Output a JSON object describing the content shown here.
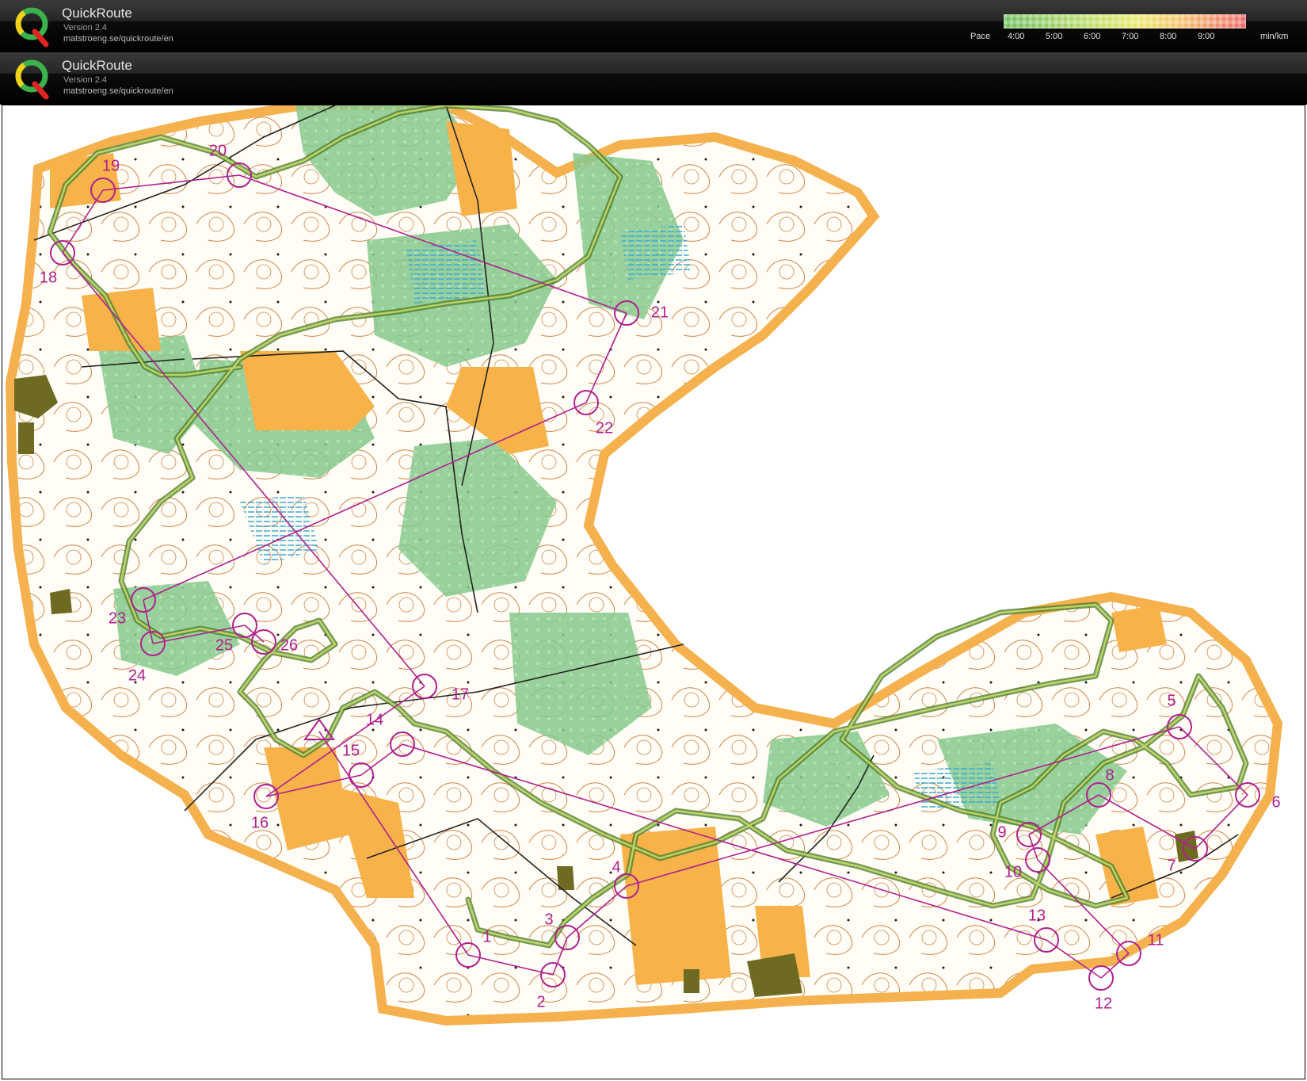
{
  "header_top": {
    "app_name": "QuickRoute",
    "version": "Version 2.4",
    "url": "matstroeng.se/quickroute/en"
  },
  "header_second": {
    "app_name": "QuickRoute",
    "version": "Version 2.4",
    "url": "matstroeng.se/quickroute/en"
  },
  "pace_legend": {
    "label": "Pace",
    "ticks": [
      "4:00",
      "5:00",
      "6:00",
      "7:00",
      "8:00",
      "9:00"
    ],
    "unit": "min/km",
    "colors": [
      "#6fbf5f",
      "#c8e06b",
      "#e9e870",
      "#f5c76d",
      "#ea6a6a"
    ]
  },
  "map": {
    "colors": {
      "course": "#b0208f",
      "route": "#6f9a43",
      "open": "#f7b34a",
      "forest_green": "#7cc48a",
      "marsh": "#48b8d8",
      "contour": "#c8783a",
      "buildings": "#6e6a22"
    },
    "controls": [
      {
        "num": "1"
      },
      {
        "num": "2"
      },
      {
        "num": "3"
      },
      {
        "num": "4"
      },
      {
        "num": "5"
      },
      {
        "num": "6"
      },
      {
        "num": "7"
      },
      {
        "num": "8"
      },
      {
        "num": "9"
      },
      {
        "num": "10"
      },
      {
        "num": "11"
      },
      {
        "num": "12"
      },
      {
        "num": "13"
      },
      {
        "num": "14"
      },
      {
        "num": "15"
      },
      {
        "num": "16"
      },
      {
        "num": "17"
      },
      {
        "num": "18"
      },
      {
        "num": "19"
      },
      {
        "num": "20"
      },
      {
        "num": "21"
      },
      {
        "num": "22"
      },
      {
        "num": "23"
      },
      {
        "num": "24"
      },
      {
        "num": "25"
      },
      {
        "num": "26"
      }
    ]
  }
}
